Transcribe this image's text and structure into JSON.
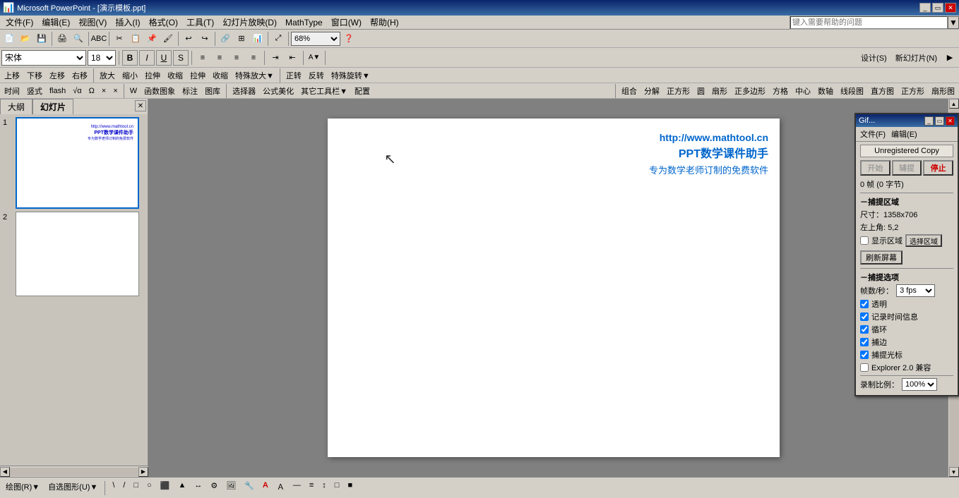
{
  "titleBar": {
    "title": "Microsoft PowerPoint - [演示模板.ppt]",
    "icon": "ppt-icon",
    "controls": [
      "minimize",
      "restore",
      "close"
    ]
  },
  "menuBar": {
    "items": [
      "文件(F)",
      "编辑(E)",
      "视图(V)",
      "插入(I)",
      "格式(O)",
      "工具(T)",
      "幻灯片放映(D)",
      "MathType",
      "窗口(W)",
      "帮助(H)"
    ]
  },
  "toolbar1": {
    "buttons": [
      "new",
      "open",
      "save",
      "print",
      "preview",
      "spell",
      "cut",
      "copy",
      "paste",
      "format-painter",
      "undo",
      "redo",
      "insert-hyperlink",
      "tables",
      "insert-excel",
      "columns",
      "drawing",
      "expand",
      "zoom"
    ]
  },
  "zoomLevel": "68%",
  "fontToolbar": {
    "fontName": "宋体",
    "fontSize": "18",
    "bold": "B",
    "italic": "I",
    "underline": "U",
    "shadow": "S",
    "alignLeft": "≡",
    "alignCenter": "≡",
    "alignRight": "≡",
    "design": "设计(S)",
    "newSlide": "新幻灯片(N)"
  },
  "toolbar2": {
    "items": [
      "上移",
      "下移",
      "左移",
      "右移",
      "放大",
      "缩小",
      "拉伸",
      "收缩",
      "拉伸",
      "收缩",
      "特殊放大▼",
      "正转",
      "反转",
      "特殊旋转▼"
    ]
  },
  "toolbar3": {
    "items": [
      "时间",
      "竖式",
      "flash",
      "√α",
      "Ω",
      "×",
      "×",
      "W",
      "函数图象",
      "标注",
      "图库",
      "选择器",
      "公式美化",
      "其它工具栏▼",
      "配置"
    ]
  },
  "toolbar4": {
    "items": [
      "组合",
      "分解",
      "正方形",
      "圆",
      "扇形",
      "正多边形",
      "方格",
      "中心",
      "数轴",
      "线段图",
      "直方图",
      "正方形",
      "扇形图"
    ]
  },
  "slidePanel": {
    "tabs": [
      "大纲",
      "幻灯片"
    ],
    "activeTab": "幻灯片",
    "slides": [
      {
        "number": "1",
        "thumbContent": "http://www.mathtool.cn\nPPT数学课件助手\n专为数学老师订制的免费软件"
      },
      {
        "number": "2",
        "thumbContent": ""
      }
    ]
  },
  "slideCanvas": {
    "url": "http://www.mathtool.cn",
    "title": "PPT数学课件助手",
    "subtitle": "专为数学老师订制的免费软件"
  },
  "gifPanel": {
    "title": "Gif...",
    "menuItems": [
      "文件(F)",
      "编辑(E)"
    ],
    "unregistered": "Unregistered Copy",
    "buttons": {
      "start": "开始",
      "assist": "辅提",
      "stop": "停止"
    },
    "frameInfo": "0 帧 (0 字节)",
    "captureArea": {
      "sectionTitle": "－捕提区域",
      "size": "尺寸：1358x706",
      "topLeft": "左上角: 5,2",
      "showArea": "显示区域",
      "selectArea": "选择区域"
    },
    "refreshBtn": "刷新屏幕",
    "captureOptions": {
      "sectionTitle": "－捕提选项",
      "fps": "帧数/秒：",
      "fpsValue": "3 fps",
      "transparent": "透明",
      "recordTime": "记录时间信息",
      "loop": "循环",
      "capture": "捕边",
      "captureCursor": "捕提光标",
      "explorerCompat": "Explorer 2.0 兼容"
    },
    "recordRatio": "录制比例：",
    "recordRatioValue": "100%"
  },
  "statusBar": {
    "drawLabel": "绘图(R)▼",
    "autoShapes": "自选图形(U)▼",
    "tools": [
      "\\",
      "/",
      "□",
      "○",
      "⬛",
      "▲",
      "↔",
      "⚙",
      "📷",
      "🔧",
      "A",
      "≡",
      "—",
      "≡",
      "↕",
      "□",
      "■"
    ]
  },
  "searchBar": {
    "placeholder": "键入需要帮助的问题"
  }
}
